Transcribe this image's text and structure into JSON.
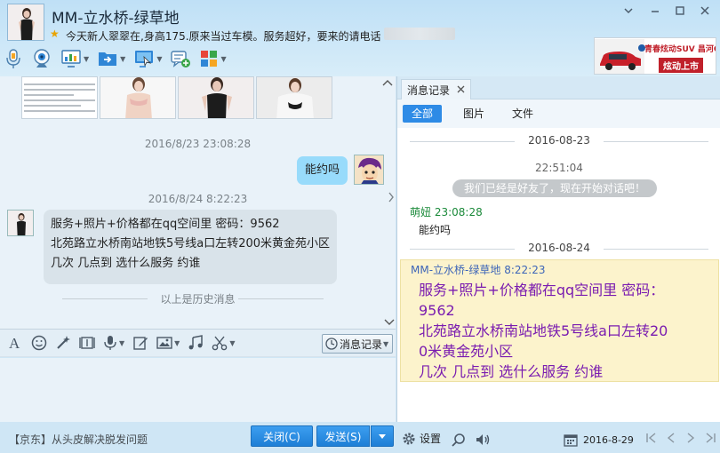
{
  "window": {
    "title": "MM-立水桥-绿草地",
    "signature": "今天新人翠翠在,身高175.原来当过车模。服务超好，要来的请电话",
    "controls": {
      "minimize": "−",
      "maximize": "□",
      "close": "×",
      "menu": "⌄"
    }
  },
  "toolbar": {
    "items": [
      {
        "name": "mic-icon",
        "has_menu": false
      },
      {
        "name": "webcam-icon",
        "has_menu": false
      },
      {
        "name": "screen-share-icon",
        "has_menu": true
      },
      {
        "name": "file-transfer-icon",
        "has_menu": true
      },
      {
        "name": "remote-desktop-icon",
        "has_menu": true
      },
      {
        "name": "add-chat-icon",
        "has_menu": false
      },
      {
        "name": "apps-icon",
        "has_menu": true
      }
    ]
  },
  "ad": {
    "brand": "青春炫动SUV 昌河Q35",
    "tagline": "炫动上市"
  },
  "chat": {
    "messages": [
      {
        "timestamp": "2016/8/23 23:08:28",
        "direction": "outgoing",
        "text": "能约吗"
      },
      {
        "timestamp": "2016/8/24 8:22:23",
        "direction": "incoming",
        "lines": [
          "服务+照片+价格都在qq空间里 密码：9562",
          "北苑路立水桥南站地铁5号线a口左转200米黄金苑小区",
          "几次 几点到 选什么服务 约谁"
        ]
      }
    ],
    "history_divider": "以上是历史消息"
  },
  "input_toolbar": {
    "message_record_label": "消息记录",
    "icons": [
      "font-icon",
      "emoji-icon",
      "magic-icon",
      "gif-icon",
      "voice-icon",
      "edit-icon",
      "image-icon",
      "music-icon",
      "screenshot-icon"
    ]
  },
  "bottom": {
    "promo": "【京东】从头皮解决脱发问题",
    "close_label": "关闭(C)",
    "send_label": "发送(S)",
    "settings_label": "设置",
    "date": "2016-8-29"
  },
  "record_panel": {
    "tab_label": "消息记录",
    "filters": [
      "全部",
      "图片",
      "文件"
    ],
    "entries": {
      "date1": "2016-08-23",
      "time1": "22:51:04",
      "system_msg": "我们已经是好友了，现在开始对话吧！",
      "sender1": "萌妞",
      "sender1_time": "23:08:28",
      "msg1": "能约吗",
      "date2": "2016-08-24",
      "sender2": "MM-立水桥-绿草地",
      "sender2_time": "8:22:23",
      "msg2_lines": [
        "服务+照片+价格都在qq空间里 密码：",
        "9562",
        "北苑路立水桥南站地铁5号线a口左转20",
        "0米黄金苑小区",
        "几次 几点到 选什么服务 约谁"
      ]
    }
  },
  "colors": {
    "accent": "#2e8be6",
    "bubble_out": "#98dbfb",
    "bubble_in": "#d9e3ea",
    "highlight": "#fcf3cc",
    "sender_green": "#1b8a3a",
    "message_purple": "#7a1cb0"
  }
}
